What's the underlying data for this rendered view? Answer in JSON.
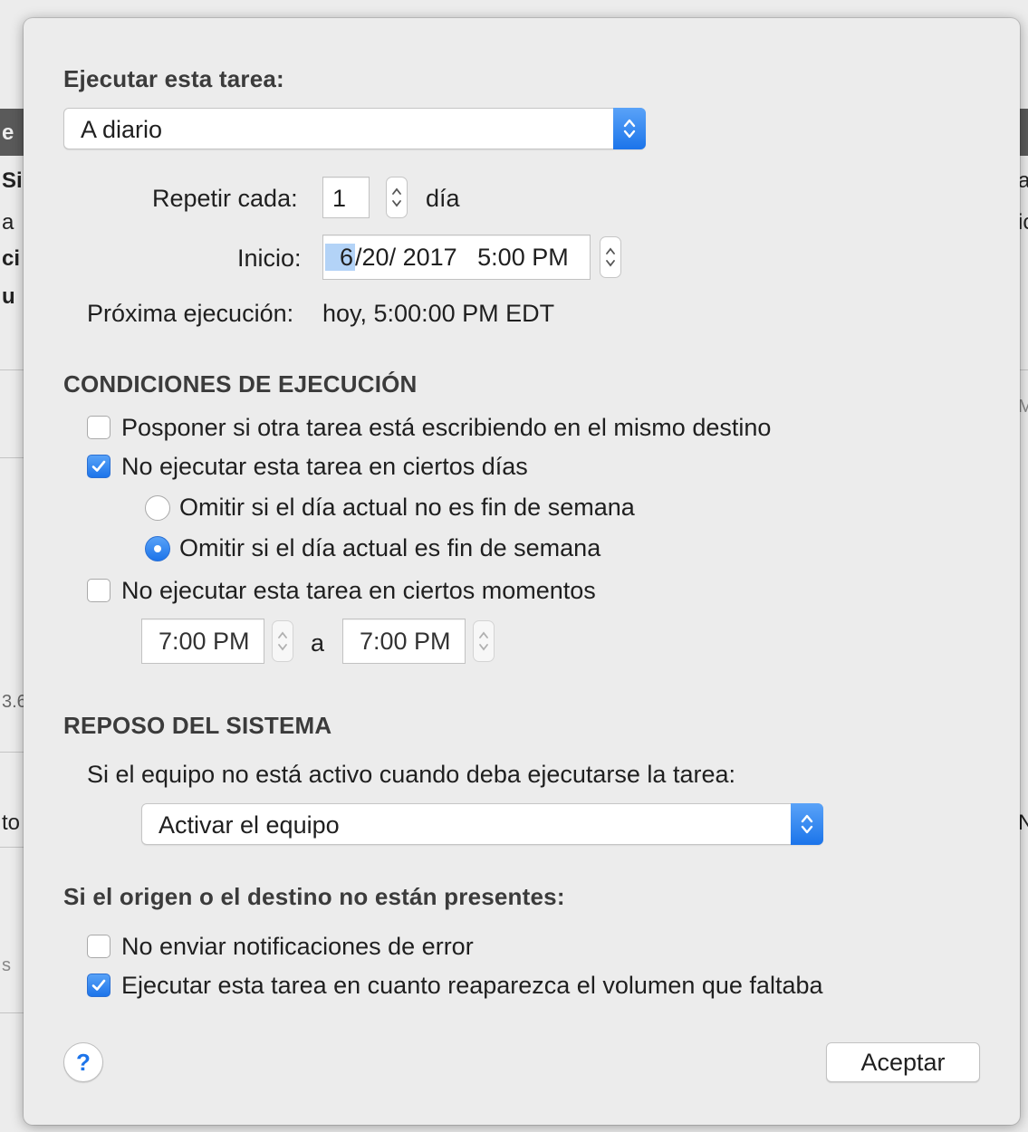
{
  "background_window": {
    "fragments_left": [
      "e",
      "Si",
      "a",
      "ci",
      "u",
      "3.6",
      "to",
      "s"
    ],
    "fragments_right": [
      "a",
      "ic",
      "M",
      "N"
    ]
  },
  "dialog": {
    "run_task_heading": "Ejecutar esta tarea:",
    "frequency_popup": {
      "value": "A diario"
    },
    "repeat_every": {
      "label": "Repetir cada:",
      "value": "1",
      "unit": "día"
    },
    "start": {
      "label": "Inicio:",
      "date_highlight": "6",
      "date_rest": "/20/ 2017",
      "time": "5:00 PM"
    },
    "next_run": {
      "label": "Próxima ejecución:",
      "value": "hoy, 5:00:00 PM EDT"
    },
    "run_conditions": {
      "heading": "CONDICIONES DE EJECUCIÓN",
      "postpone": {
        "label": "Posponer si otra tarea está escribiendo en el mismo destino",
        "checked": false
      },
      "skip_days": {
        "label": "No ejecutar esta tarea en ciertos días",
        "checked": true
      },
      "radio_weekday": {
        "label": "Omitir si el día actual no es fin de semana",
        "selected": false
      },
      "radio_weekend": {
        "label": "Omitir si el día actual es fin de semana",
        "selected": true
      },
      "skip_times": {
        "label": "No ejecutar esta tarea en ciertos momentos",
        "checked": false
      },
      "time_from": "7:00 PM",
      "time_separator": "a",
      "time_to": "7:00 PM"
    },
    "system_sleep": {
      "heading": "REPOSO DEL SISTEMA",
      "prompt": "Si el equipo no está activo cuando deba ejecutarse la tarea:",
      "action_popup": {
        "value": "Activar el equipo"
      }
    },
    "missing_volumes": {
      "heading": "Si el origen o el destino no están presentes:",
      "no_error_notifications": {
        "label": "No enviar notificaciones de error",
        "checked": false
      },
      "run_on_reappear": {
        "label": "Ejecutar esta tarea en cuanto reaparezca el volumen que faltaba",
        "checked": true
      }
    },
    "help_button": {
      "label": "?"
    },
    "ok_button": {
      "label": "Aceptar"
    }
  },
  "colors": {
    "accent": "#1c74ea",
    "sheet_background": "#ececec",
    "selection_highlight": "#b3d3f7"
  }
}
